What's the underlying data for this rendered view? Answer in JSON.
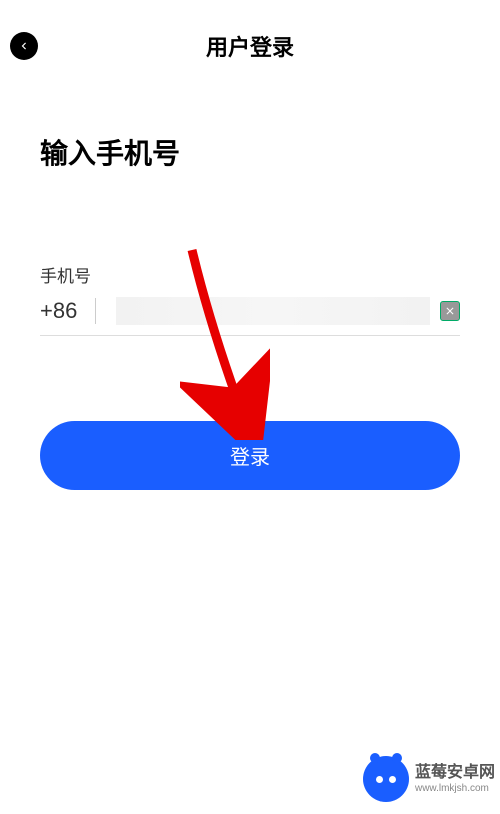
{
  "header": {
    "title": "用户登录"
  },
  "content": {
    "heading": "输入手机号",
    "phone_label": "手机号",
    "country_code": "+86",
    "login_button_label": "登录"
  },
  "watermark": {
    "title": "蓝莓安卓网",
    "url": "www.lmkjsh.com"
  }
}
